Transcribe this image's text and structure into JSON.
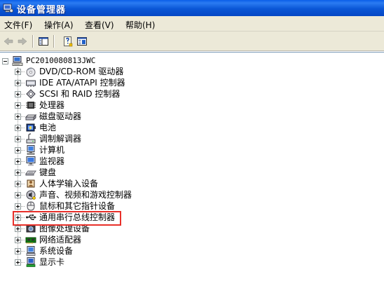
{
  "window": {
    "title": "设备管理器",
    "icon": "device-manager-icon"
  },
  "menu": [
    {
      "label": "文件(F)"
    },
    {
      "label": "操作(A)"
    },
    {
      "label": "查看(V)"
    },
    {
      "label": "帮助(H)"
    }
  ],
  "toolbar": {
    "buttons": [
      "back-arrow-icon",
      "forward-arrow-icon",
      "show-hide-tree-icon",
      "properties-help-icon",
      "console-view-icon"
    ]
  },
  "tree": {
    "root": {
      "label": "PC2010080813JWC",
      "icon": "computer-icon"
    },
    "items": [
      {
        "label": "DVD/CD-ROM 驱动器",
        "icon": "cdrom-icon"
      },
      {
        "label": "IDE ATA/ATAPI 控制器",
        "icon": "ide-controller-icon"
      },
      {
        "label": "SCSI 和 RAID 控制器",
        "icon": "scsi-raid-icon"
      },
      {
        "label": "处理器",
        "icon": "processor-icon"
      },
      {
        "label": "磁盘驱动器",
        "icon": "disk-drive-icon"
      },
      {
        "label": "电池",
        "icon": "battery-icon"
      },
      {
        "label": "调制解调器",
        "icon": "modem-icon"
      },
      {
        "label": "计算机",
        "icon": "computer-node-icon"
      },
      {
        "label": "监视器",
        "icon": "monitor-icon"
      },
      {
        "label": "键盘",
        "icon": "keyboard-icon"
      },
      {
        "label": "人体学输入设备",
        "icon": "hid-icon"
      },
      {
        "label": "声音、视频和游戏控制器",
        "icon": "sound-video-icon"
      },
      {
        "label": "鼠标和其它指针设备",
        "icon": "mouse-icon"
      },
      {
        "label": "通用串行总线控制器",
        "icon": "usb-icon"
      },
      {
        "label": "图像处理设备",
        "icon": "imaging-icon"
      },
      {
        "label": "网络适配器",
        "icon": "network-adapter-icon"
      },
      {
        "label": "系统设备",
        "icon": "system-device-icon"
      },
      {
        "label": "显示卡",
        "icon": "display-adapter-icon"
      }
    ]
  },
  "highlight": {
    "item": "通用串行总线控制器",
    "color": "#e8302a"
  }
}
